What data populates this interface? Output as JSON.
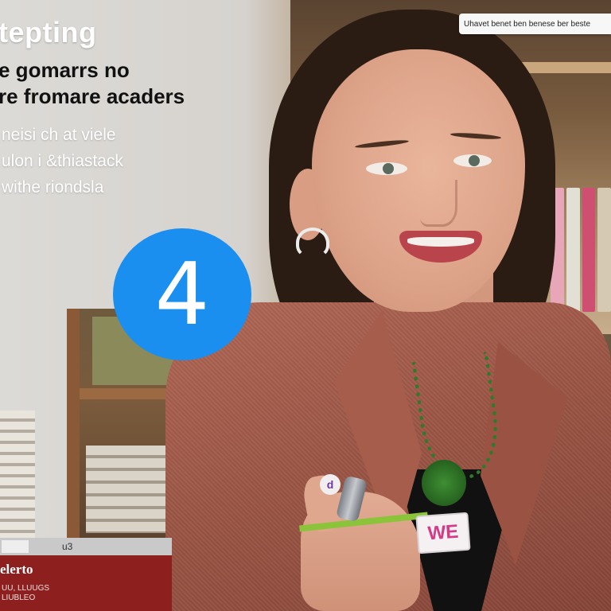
{
  "headline": {
    "title": "tepting",
    "line1": "e gomarrs no",
    "line2": "re fromare acaders"
  },
  "body": {
    "line1": "neisi ch at viele",
    "line2": "ulon i &thiastack",
    "line3": "withe riondsla"
  },
  "badge": {
    "number": "4",
    "color": "#1a8ff0"
  },
  "top_bar": {
    "text": "Uhavet benet ben benese ber beste"
  },
  "laptop": {
    "tab": "",
    "tab_label": "u3",
    "title": "elerto",
    "sub1": "UU, LLUUGS",
    "sub2": "LIUBLEO"
  },
  "tag": {
    "text": "WE",
    "small": "d"
  },
  "colors": {
    "accent_blue": "#1a8ff0",
    "jacket": "#9c5646",
    "tag_text": "#d33b86"
  }
}
